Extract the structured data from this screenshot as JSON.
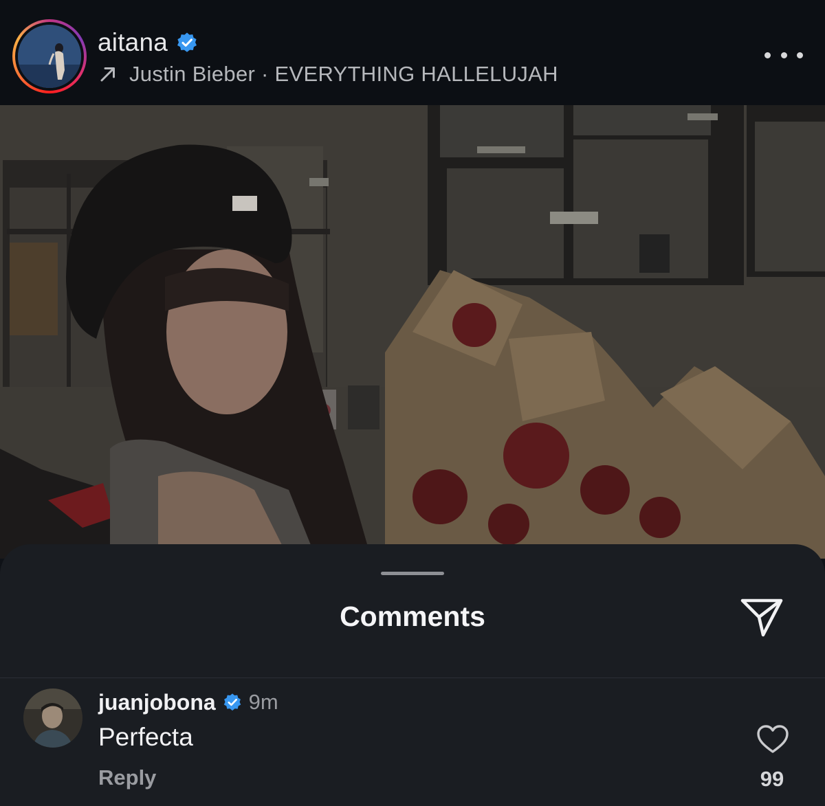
{
  "post": {
    "username": "aitana",
    "verified": true,
    "music_arrow_icon": "arrow-up-right-icon",
    "music": "Justin Bieber · EVERYTHING HALLELUJAH",
    "more_icon": "more-horizontal-icon"
  },
  "comments_sheet": {
    "title": "Comments",
    "share_icon": "send-icon",
    "comments": [
      {
        "username": "juanjobona",
        "verified": true,
        "time": "9m",
        "text": "Perfecta",
        "reply_label": "Reply",
        "like_icon": "heart-icon",
        "like_count": "99"
      }
    ]
  },
  "colors": {
    "background": "#0f1217",
    "sheet": "#1a1d22",
    "verified_blue": "#3897f0"
  }
}
